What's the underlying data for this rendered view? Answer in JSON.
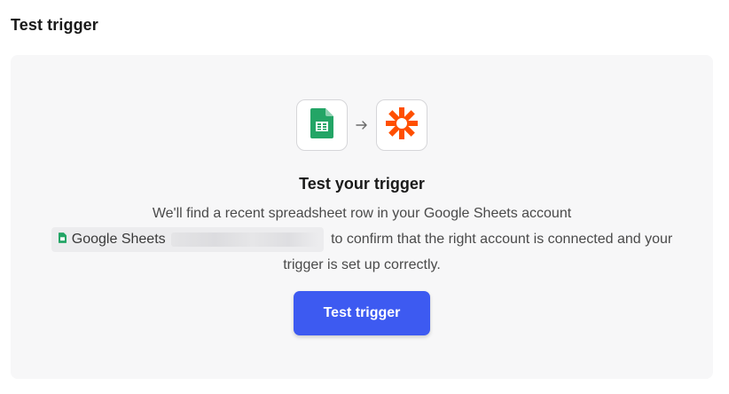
{
  "section": {
    "title": "Test trigger"
  },
  "card": {
    "source_app_icon": "google-sheets-icon",
    "arrow_icon": "arrow-right-icon",
    "destination_app_icon": "zapier-icon",
    "heading": "Test your trigger",
    "description_start": "We'll find a recent spreadsheet row in your Google Sheets account",
    "account_chip": {
      "icon": "google-sheets-icon",
      "label": "Google Sheets"
    },
    "description_end": "to confirm that the right account is connected and your trigger is set up correctly.",
    "button_label": "Test trigger"
  },
  "colors": {
    "primary_button": "#3d5af1",
    "sheets_green": "#23a566",
    "zapier_orange": "#ff4f00",
    "card_background": "#f7f7f8"
  }
}
